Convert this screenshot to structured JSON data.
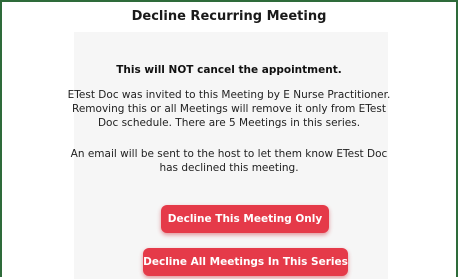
{
  "dialog": {
    "title": "Decline Recurring Meeting",
    "warning": "This will NOT cancel the appointment.",
    "paragraph1": [
      "ETest Doc was invited to this Meeting by E Nurse Practitioner.",
      "Removing this or all Meetings will remove it only from ETest",
      "Doc schedule. There are 5 Meetings in this series."
    ],
    "paragraph2": [
      "An email will be sent to the host to let them know ETest Doc",
      "has declined this meeting."
    ],
    "decline_one_label": "Decline This Meeting Only",
    "decline_all_label": "Decline All Meetings In This Series"
  },
  "colors": {
    "border": "#2e6b3a",
    "button": "#e53a49",
    "panel": "#f6f6f6"
  }
}
